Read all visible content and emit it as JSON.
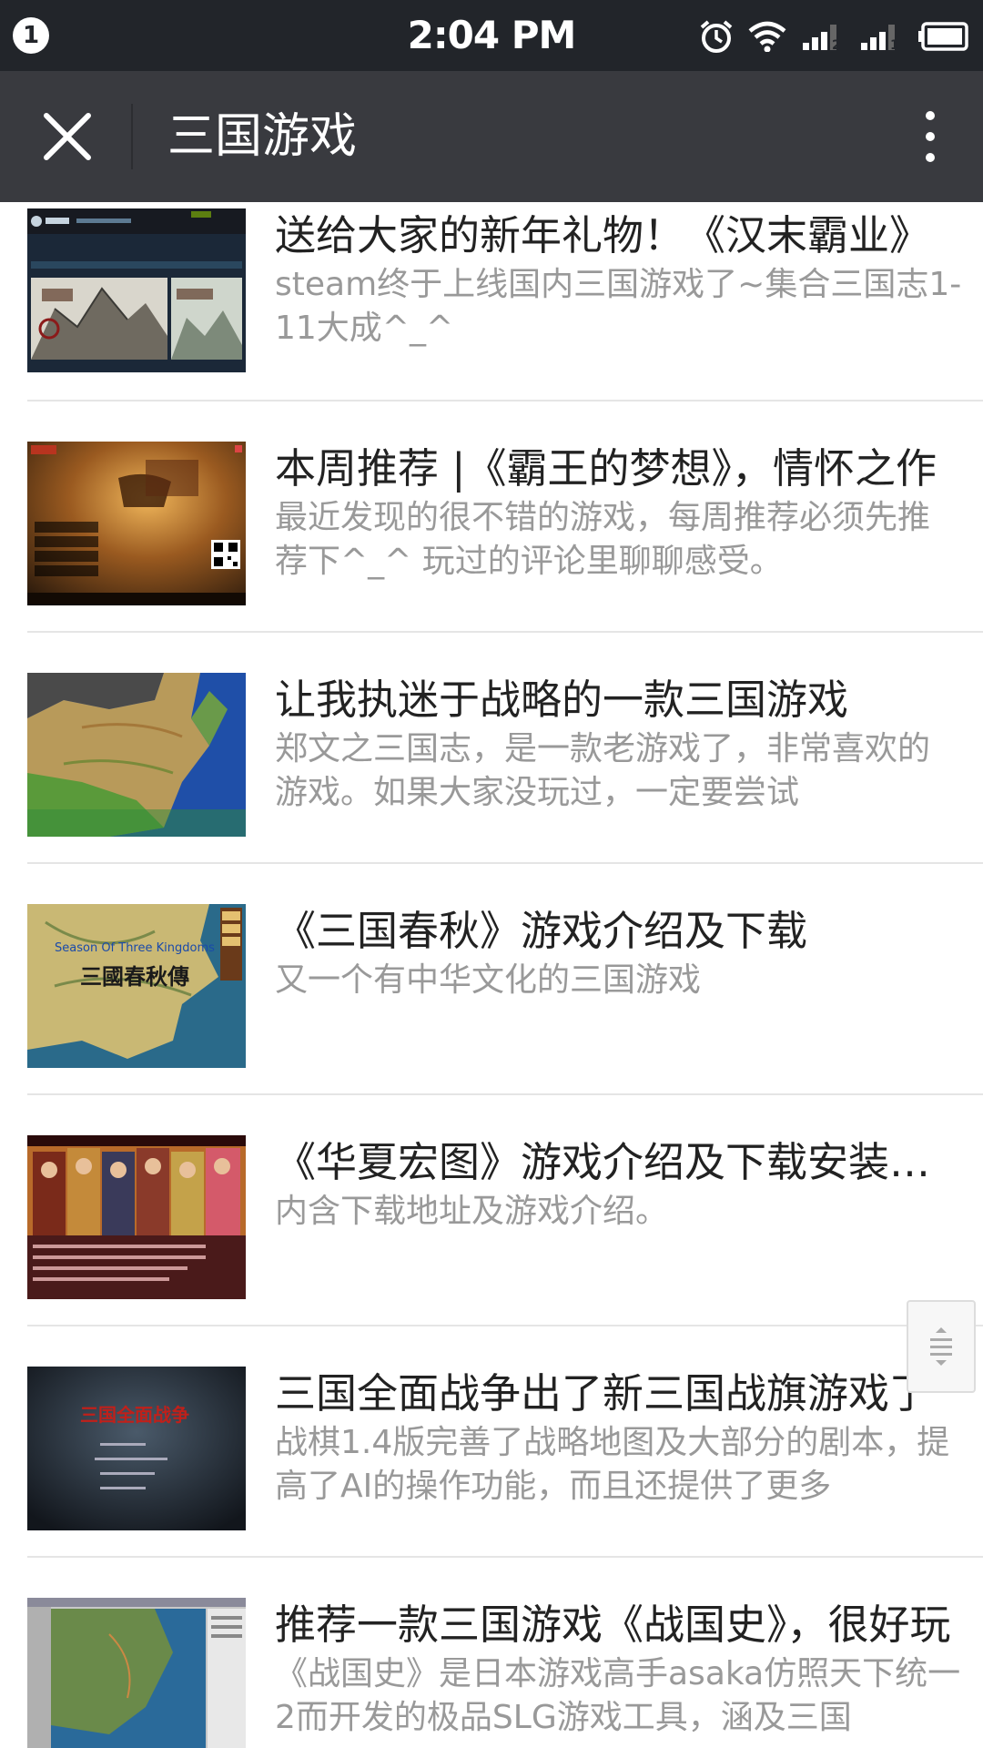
{
  "status_bar": {
    "notification_count": "1",
    "time": "2:04 PM",
    "sim1": "2",
    "sim2": "1"
  },
  "header": {
    "title": "三国游戏"
  },
  "articles": [
    {
      "title": "送给大家的新年礼物！《汉末霸业》",
      "summary": "steam终于上线国内三国游戏了~集合三国志1-11大成^_^",
      "thumb": "steam-store-screenshot"
    },
    {
      "title": "本周推荐 |《霸王的梦想》，情怀之作",
      "summary": "最近发现的很不错的游戏，每周推荐必须先推荐下^_^ 玩过的评论里聊聊感受。",
      "thumb": "bawang-game-menu"
    },
    {
      "title": "让我执迷于战略的一款三国游戏",
      "summary": "郑文之三国志，是一款老游戏了，非常喜欢的游戏。如果大家没玩过，一定要尝试",
      "thumb": "china-map"
    },
    {
      "title": "《三国春秋》游戏介绍及下载",
      "summary": "又一个有中华文化的三国游戏",
      "thumb": "season-of-three-kingdoms",
      "thumb_text": {
        "en": "Season Of Three Kingdoms",
        "zh": "三國春秋傳"
      }
    },
    {
      "title": "《华夏宏图》游戏介绍及下载安装教程",
      "summary": "内含下载地址及游戏介绍。",
      "thumb": "huaxia-characters"
    },
    {
      "title": "三国全面战争出了新三国战旗游戏了",
      "summary": "战棋1.4版完善了战略地图及大部分的剧本，提高了AI的操作功能，而且还提供了更多",
      "thumb": "total-war-menu",
      "thumb_text": {
        "zh": "三国全面战争"
      }
    },
    {
      "title": "推荐一款三国游戏《战国史》，很好玩",
      "summary": "《战国史》是日本游戏高手asaka仿照天下统一2而开发的极品SLG游戏工具，涵及三国",
      "thumb": "zhanguoshi-map"
    }
  ],
  "colors": {
    "status_bar": "#22252a",
    "title_bar": "#393a3f",
    "title_text": "#222222",
    "summary_text": "#999999",
    "divider": "#e5e5e5"
  }
}
